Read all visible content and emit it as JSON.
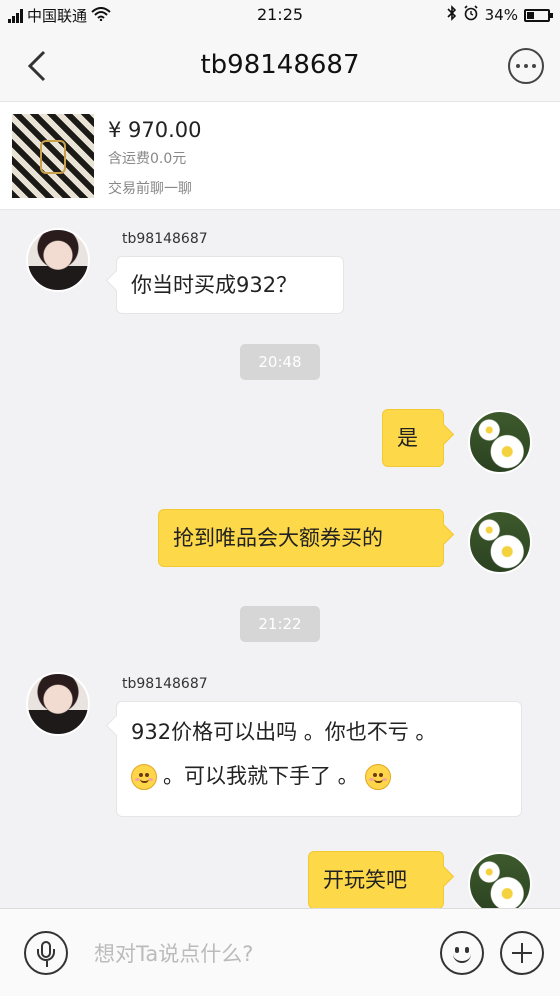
{
  "status_bar": {
    "carrier": "中国联通",
    "time": "21:25",
    "battery": "34%",
    "battery_level": 0.34
  },
  "nav": {
    "title": "tb98148687"
  },
  "product": {
    "price": "¥ 970.00",
    "shipping": "含运费0.0元",
    "pre_chat": "交易前聊一聊"
  },
  "messages": [
    {
      "direction": "incoming",
      "sender": "tb98148687",
      "text": "你当时买成932？"
    },
    {
      "type": "timestamp",
      "text": "20:48"
    },
    {
      "direction": "outgoing",
      "text": "是"
    },
    {
      "direction": "outgoing",
      "text": "抢到唯品会大额券买的"
    },
    {
      "type": "timestamp",
      "text": "21:22"
    },
    {
      "direction": "incoming",
      "sender": "tb98148687",
      "text_line1": "932价格可以出吗 。你也不亏 。",
      "text_line2": "。可以我就下手了 。",
      "emoji_icons": [
        "smile-emoji-icon",
        "shy-emoji-icon"
      ]
    },
    {
      "direction": "outgoing",
      "text": "开玩笑吧"
    }
  ],
  "input_bar": {
    "placeholder": "想对Ta说点什么?"
  },
  "colors": {
    "outgoing_bubble": "#fdd848",
    "incoming_bubble": "#ffffff",
    "background": "#f2f2f4"
  }
}
